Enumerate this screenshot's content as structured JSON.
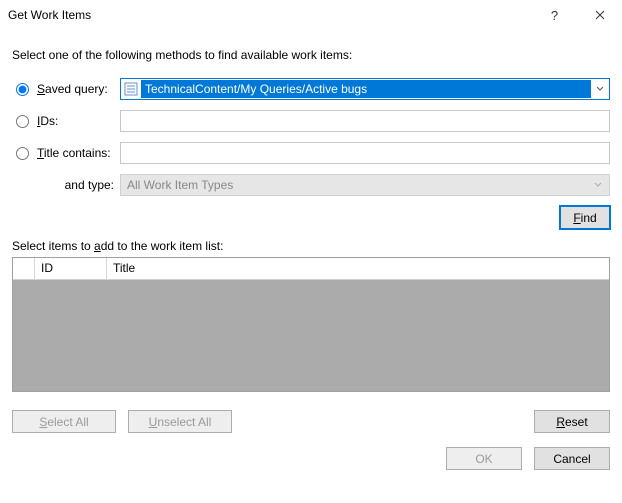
{
  "window": {
    "title": "Get Work Items"
  },
  "instruction": "Select one of the following methods to find available work items:",
  "method": {
    "saved_query": {
      "label_pre": "S",
      "label_post": "aved query:",
      "value": "TechnicalContent/My Queries/Active bugs"
    },
    "ids": {
      "label_pre": "I",
      "label_post": "Ds:",
      "value": ""
    },
    "title_contains": {
      "label_pre": "T",
      "label_post": "itle contains:",
      "value": ""
    },
    "and_type": {
      "label": "and type:",
      "value": "All Work Item Types"
    }
  },
  "buttons": {
    "find_pre": "F",
    "find_post": "ind",
    "select_all_pre": "S",
    "select_all_post": "elect All",
    "unselect_all_pre": "U",
    "unselect_all_post": "nselect All",
    "reset_pre": "R",
    "reset_post": "eset",
    "ok": "OK",
    "cancel": "Cancel"
  },
  "grid": {
    "instruction_pre": "Select items to ",
    "instruction_u": "a",
    "instruction_post": "dd to the work item list:",
    "col_id": "ID",
    "col_title": "Title",
    "rows": []
  }
}
